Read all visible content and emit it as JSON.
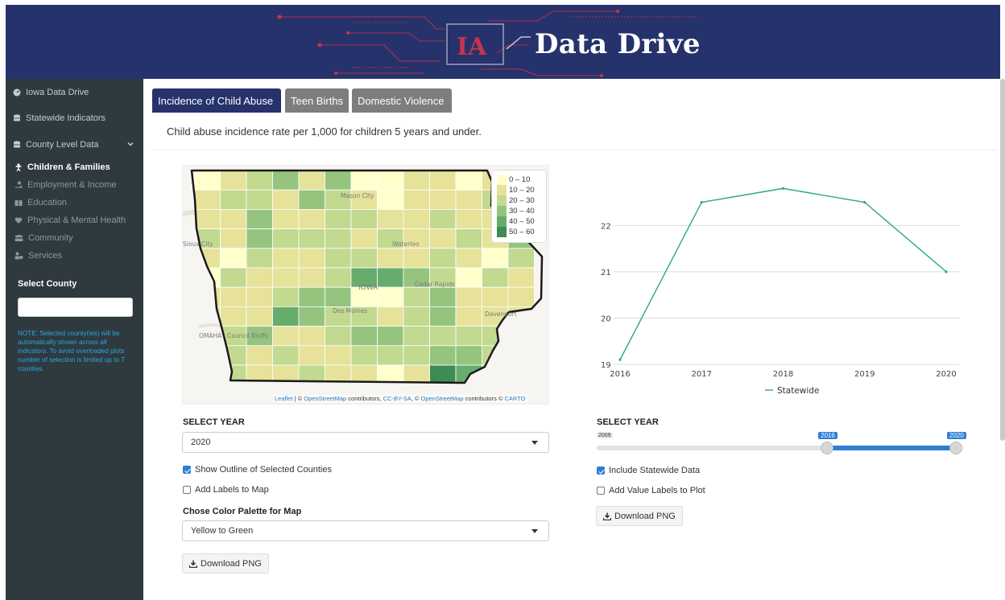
{
  "header": {
    "logo_text": "IA",
    "title": "Data Drive"
  },
  "sidebar": {
    "items": [
      {
        "label": "Iowa Data Drive",
        "icon": "dashboard-icon"
      },
      {
        "label": "Statewide Indicators",
        "icon": "database-icon"
      },
      {
        "label": "County Level Data",
        "icon": "database-icon"
      }
    ],
    "subitems": [
      {
        "label": "Children & Families",
        "icon": "child-icon",
        "active": true
      },
      {
        "label": "Employment & Income",
        "icon": "hand-coin-icon",
        "active": false
      },
      {
        "label": "Education",
        "icon": "book-icon",
        "active": false
      },
      {
        "label": "Physical & Mental Health",
        "icon": "heartbeat-icon",
        "active": false
      },
      {
        "label": "Community",
        "icon": "users-icon",
        "active": false
      },
      {
        "label": "Services",
        "icon": "user-cog-icon",
        "active": false
      }
    ],
    "select_county_label": "Select County",
    "select_county_value": "",
    "note": "NOTE: Selected county(ies) will be automatically shown across all indicators. To avoid overloaded plots number of selection is limited up to 7 counties."
  },
  "tabs": [
    {
      "label": "Incidence of Child Abuse",
      "active": true
    },
    {
      "label": "Teen Births",
      "active": false
    },
    {
      "label": "Domestic Violence",
      "active": false
    }
  ],
  "description": "Child abuse incidence rate per 1,000 for children 5 years and under.",
  "map": {
    "legend": [
      {
        "label": "0 – 10",
        "color": "#ffffcc"
      },
      {
        "label": "10 – 20",
        "color": "#e6e29a"
      },
      {
        "label": "20 – 30",
        "color": "#c2d990"
      },
      {
        "label": "30 – 40",
        "color": "#95c47f"
      },
      {
        "label": "40 – 50",
        "color": "#68ac6d"
      },
      {
        "label": "50 – 60",
        "color": "#3e8b55"
      }
    ],
    "place_labels": [
      "Mason City",
      "Waterloo",
      "IOWA",
      "Cedar Rapids",
      "Des Moines",
      "OMAHA",
      "Council Bluffs",
      "Davenport",
      "Sioux City"
    ],
    "attribution": {
      "leaflet": "Leaflet",
      "text1": " | © ",
      "osm": "OpenStreetMap",
      "text2": " contributors, ",
      "ccbysa": "CC-BY-SA",
      "text3": ", © ",
      "osm2": "OpenStreetMap",
      "text4": " contributors © ",
      "carto": "CARTO"
    }
  },
  "left_controls": {
    "select_year_label": "SELECT YEAR",
    "select_year_value": "2020",
    "show_outline_label": "Show Outline of Selected Counties",
    "show_outline_checked": true,
    "add_labels_label": "Add Labels to Map",
    "add_labels_checked": false,
    "palette_label": "Chose Color Palette for Map",
    "palette_value": "Yellow to Green",
    "download_label": "Download PNG"
  },
  "right_controls": {
    "select_year_label": "SELECT YEAR",
    "slider_min": "2009",
    "slider_from": "2016",
    "slider_to": "2020",
    "include_statewide_label": "Include Statewide Data",
    "include_statewide_checked": true,
    "add_value_labels_label": "Add Value Labels to Plot",
    "add_value_labels_checked": false,
    "download_label": "Download PNG"
  },
  "chart_data": {
    "type": "line",
    "x": [
      2016,
      2017,
      2018,
      2019,
      2020
    ],
    "x_ticks": [
      "2016",
      "2017",
      "2018",
      "2019",
      "2020"
    ],
    "y_ticks": [
      "19",
      "20",
      "21",
      "22"
    ],
    "ylim": [
      19,
      23.1
    ],
    "series": [
      {
        "name": "Statewide",
        "values": [
          19.1,
          22.5,
          22.8,
          22.5,
          21.0
        ],
        "color": "#2bab7a"
      }
    ],
    "legend_position": "bottom",
    "grid": true
  }
}
